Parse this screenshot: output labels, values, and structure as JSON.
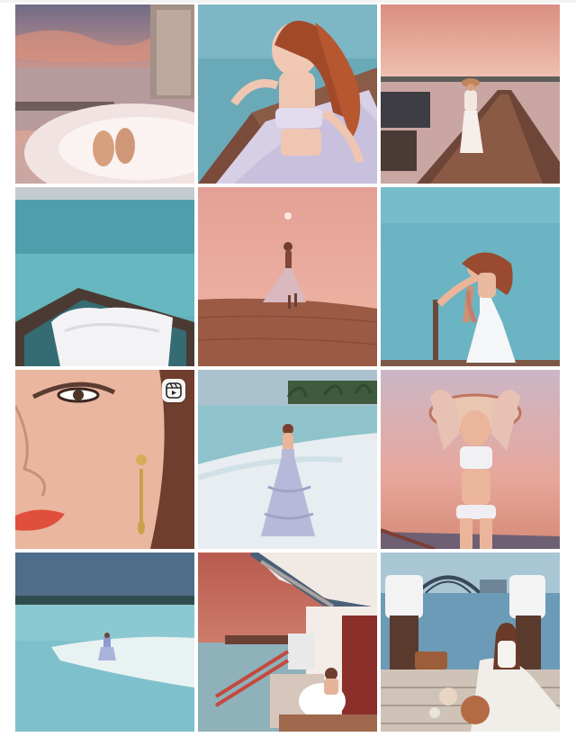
{
  "grid": {
    "posts": [
      {
        "scene": "sunset-bathtub-balcony",
        "icon": null
      },
      {
        "scene": "woman-lying-on-deck-by-lagoon",
        "icon": null
      },
      {
        "scene": "woman-walking-on-pier-at-sunset",
        "icon": null
      },
      {
        "scene": "white-towel-on-overwater-net",
        "icon": null
      },
      {
        "scene": "silhouette-on-dune-pink-sky",
        "icon": null
      },
      {
        "scene": "woman-on-deck-railing-turquoise-sea",
        "icon": null
      },
      {
        "scene": "face-closeup-gold-earring",
        "icon": "reels-icon"
      },
      {
        "scene": "woman-in-tulle-skirt-on-beach",
        "icon": null
      },
      {
        "scene": "woman-with-sun-hat-pink-sky",
        "icon": null
      },
      {
        "scene": "sandbank-lagoon-tiny-figure",
        "icon": null
      },
      {
        "scene": "overwater-villa-tub-sunset",
        "icon": null
      },
      {
        "scene": "picnic-on-pier-harbour-bridge",
        "icon": null
      }
    ]
  },
  "colors": {
    "background": "#ffffff",
    "lagoon": "#7fb4c3",
    "sunset_pink": "#e5a59a",
    "deck_brown": "#8a5a45"
  }
}
